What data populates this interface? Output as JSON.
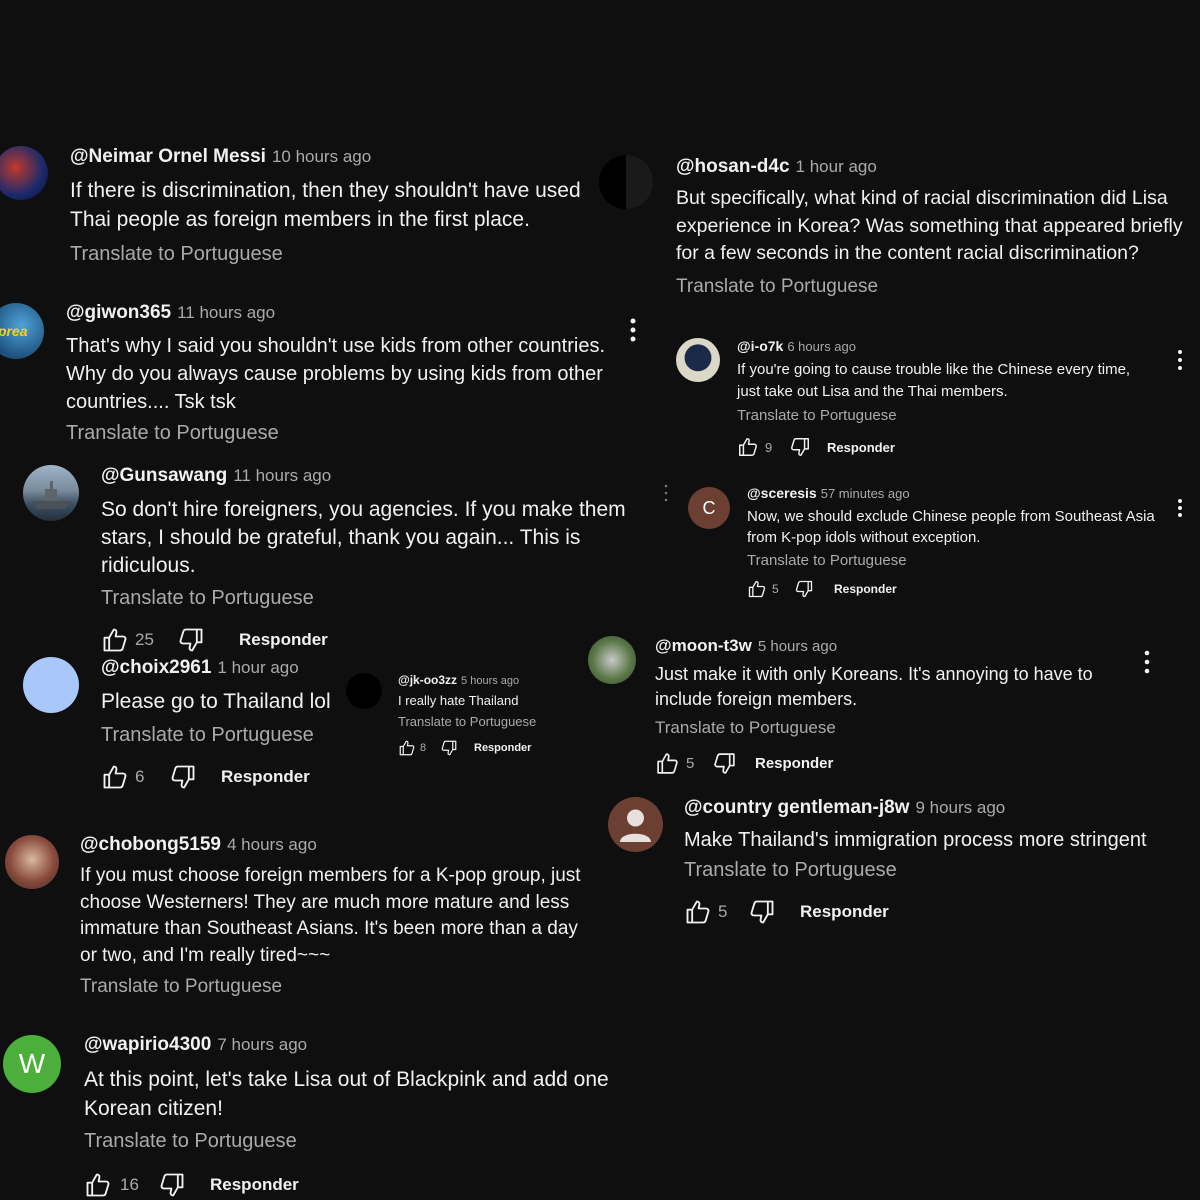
{
  "translate_label": "Translate to Portuguese",
  "reply_label": "Responder",
  "colors": {
    "background": "#0f0f0f",
    "text": "#f1f1f1",
    "muted": "#aaaaaa"
  },
  "comments": [
    {
      "handle": "@Neimar Ornel Messi",
      "time": "10 hours ago",
      "text": "If there is discrimination, then they shouldn't have used Thai people as foreign members in the first place."
    },
    {
      "handle": "@giwon365",
      "time": "11 hours ago",
      "text": "That's why I said you shouldn't use kids from other countries. Why do you always cause problems by using kids from other countries.... Tsk tsk"
    },
    {
      "handle": "@Gunsawang",
      "time": "11 hours ago",
      "text": "So don't hire foreigners, you agencies. If you make them stars, I should be grateful, thank you again... This is ridiculous.",
      "likes": "25"
    },
    {
      "handle": "@choix2961",
      "time": "1 hour ago",
      "text": "Please go to Thailand lol",
      "likes": "6"
    },
    {
      "handle": "@jk-oo3zz",
      "time": "5 hours ago",
      "text": "I really hate Thailand",
      "likes": "8"
    },
    {
      "handle": "@chobong5159",
      "time": "4 hours ago",
      "text": "If you must choose foreign members for a K-pop group, just choose Westerners! They are much more mature and less immature than Southeast Asians. It's been more than a day or two, and I'm really tired~~~"
    },
    {
      "handle": "@wapirio4300",
      "time": "7 hours ago",
      "text": "At this point, let's take Lisa out of Blackpink and add one Korean citizen!",
      "likes": "16",
      "avatar_letter": "W"
    },
    {
      "handle": "@hosan-d4c",
      "time": "1 hour ago",
      "text": "But specifically, what kind of racial discrimination did Lisa experience in Korea? Was something that appeared briefly for a few seconds in the content racial discrimination?"
    },
    {
      "handle": "@i-o7k",
      "time": "6 hours ago",
      "text": "If you're going to cause trouble like the Chinese every time, just take out Lisa and the Thai members.",
      "likes": "9"
    },
    {
      "handle": "@sceresis",
      "time": "57 minutes ago",
      "text": "Now, we should exclude Chinese people from Southeast Asia from K-pop idols without exception.",
      "likes": "5",
      "avatar_letter": "C"
    },
    {
      "handle": "@moon-t3w",
      "time": "5 hours ago",
      "text": "Just make it with only Koreans. It's annoying to have to include foreign members.",
      "likes": "5"
    },
    {
      "handle": "@country gentleman-j8w",
      "time": "9 hours ago",
      "text": "Make Thailand's immigration process more stringent",
      "likes": "5"
    }
  ]
}
